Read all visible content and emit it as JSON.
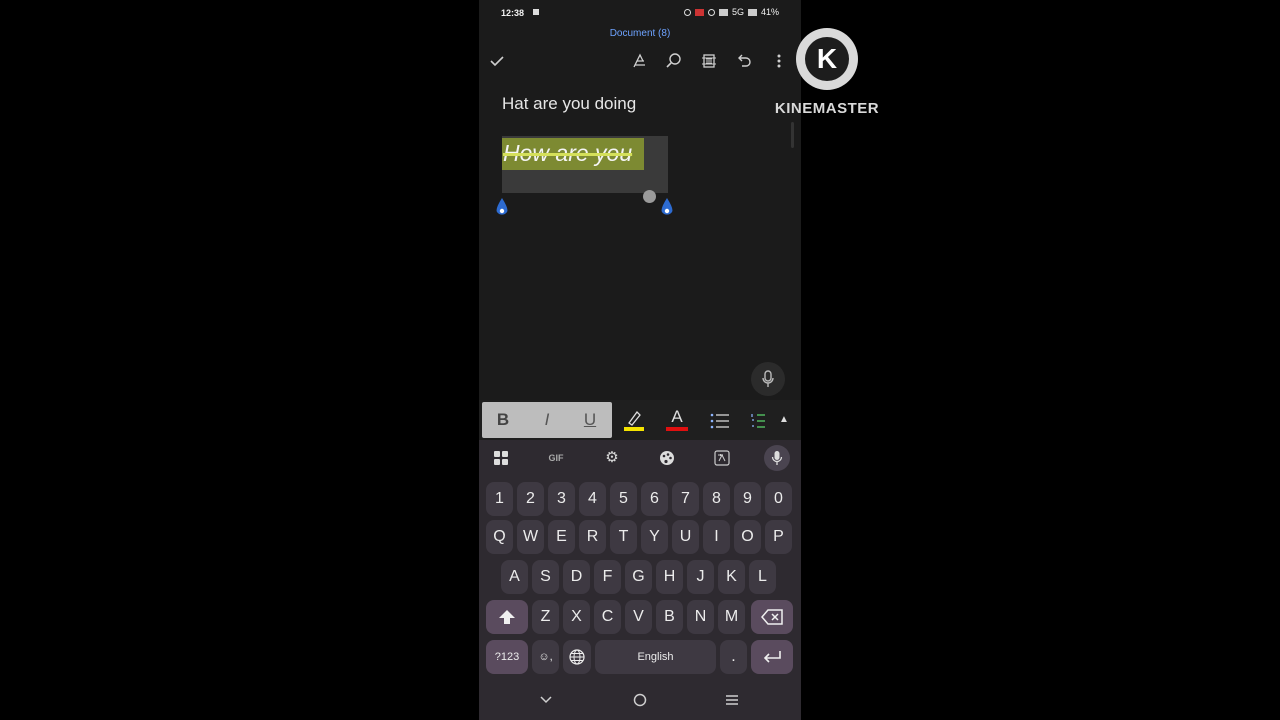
{
  "status_bar": {
    "time": "12:38",
    "battery": "41%",
    "network": "5G"
  },
  "app": {
    "document_title": "Document (8)"
  },
  "toolbar": {
    "done_icon": "check-icon",
    "draw_icon": "pen-icon",
    "search_icon": "search-icon",
    "layout_icon": "page-layout-icon",
    "undo_icon": "undo-icon",
    "more_icon": "more-vertical-icon"
  },
  "document": {
    "line1": "Hat are you doing",
    "line2": "How are you",
    "line2_highlight_color": "#7d8a32",
    "strikethrough_color": "#d5e05a"
  },
  "format_bar": {
    "bold": "B",
    "italic": "I",
    "underline": "U",
    "font_color_letter": "A",
    "highlight_color": "#f5e400",
    "font_color": "#e01010"
  },
  "keyboard": {
    "toolbar": {
      "gif": "GIF"
    },
    "row_numbers": [
      "1",
      "2",
      "3",
      "4",
      "5",
      "6",
      "7",
      "8",
      "9",
      "0"
    ],
    "row_1": [
      "Q",
      "W",
      "E",
      "R",
      "T",
      "Y",
      "U",
      "I",
      "O",
      "P"
    ],
    "row_2": [
      "A",
      "S",
      "D",
      "F",
      "G",
      "H",
      "J",
      "K",
      "L"
    ],
    "row_3": [
      "Z",
      "X",
      "C",
      "V",
      "B",
      "N",
      "M"
    ],
    "symbols_key": "?123",
    "emoji_key": "☺,",
    "space_label": "English",
    "period_key": "."
  },
  "watermark": {
    "logo_letter": "K",
    "text": "KINEMASTER"
  }
}
